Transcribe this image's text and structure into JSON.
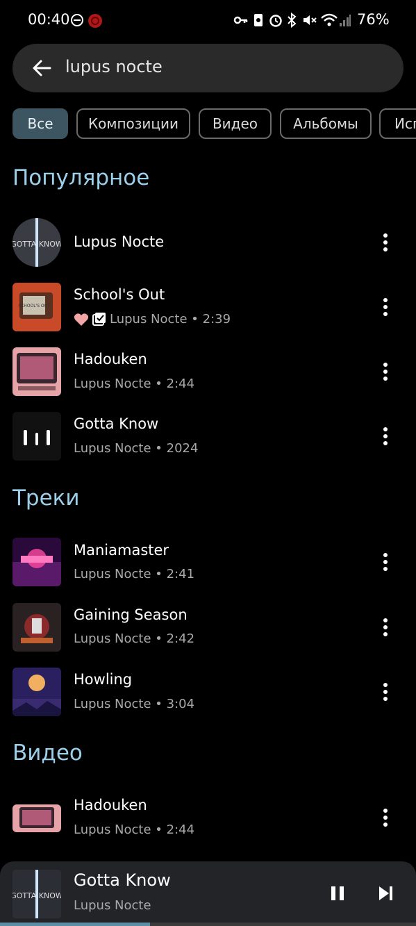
{
  "status_bar": {
    "time": "00:40",
    "battery": "76%"
  },
  "search": {
    "query": "lupus nocte"
  },
  "chips": [
    "Все",
    "Композиции",
    "Видео",
    "Альбомы",
    "Исп"
  ],
  "sections": {
    "popular": "Популярное",
    "tracks": "Треки",
    "video": "Видео"
  },
  "popular": [
    {
      "title": "Lupus Nocte",
      "subtitle": ""
    },
    {
      "title": "School's Out",
      "subtitle": "Lupus Nocte • 2:39"
    },
    {
      "title": "Hadouken",
      "subtitle": "Lupus Nocte • 2:44"
    },
    {
      "title": "Gotta Know",
      "subtitle": "Lupus Nocte • 2024"
    }
  ],
  "tracks": [
    {
      "title": "Maniamaster",
      "subtitle": "Lupus Nocte • 2:41"
    },
    {
      "title": "Gaining Season",
      "subtitle": "Lupus Nocte • 2:42"
    },
    {
      "title": "Howling",
      "subtitle": "Lupus Nocte • 3:04"
    }
  ],
  "videos": [
    {
      "title": "Hadouken",
      "subtitle": "Lupus Nocte • 2:44"
    }
  ],
  "player": {
    "title": "Gotta Know",
    "subtitle": "Lupus Nocte",
    "progress": 0.36
  },
  "colors": {
    "accent": "#9cd0ea",
    "chip_selected": "#3d5560",
    "like": "#f2a6a6"
  }
}
